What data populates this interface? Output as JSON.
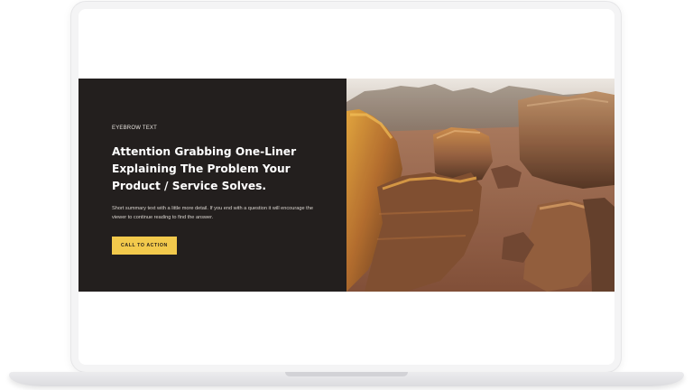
{
  "hero": {
    "eyebrow": "EYEBROW TEXT",
    "headline": "Attention Grabbing One-Liner Explaining The Problem Your Product / Service Solves.",
    "summary": "Short summary text with a little more detail. If you end with a question it will encourage the viewer to continue reading to find the answer.",
    "cta_label": "CALL TO ACTION"
  },
  "colors": {
    "panel_bg": "#231f1e",
    "cta_bg": "#f2c94c"
  }
}
